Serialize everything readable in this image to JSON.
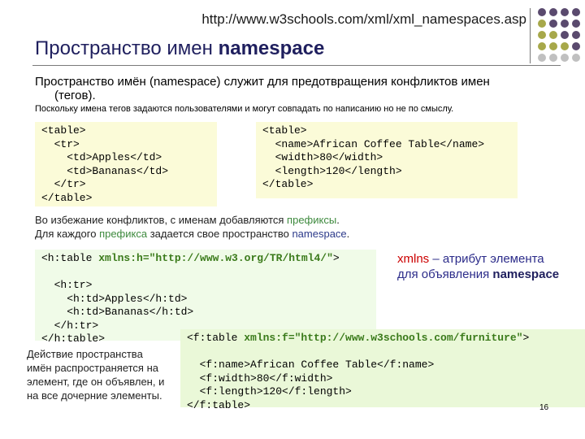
{
  "header": {
    "url": "http://www.w3schools.com/xml/xml_namespaces.asp",
    "title_normal": "Пространство имен ",
    "title_bold": "namespace",
    "dot_colors": [
      "#5a4a6e",
      "#5a4a6e",
      "#5a4a6e",
      "#5a4a6e",
      "#a7a84a",
      "#5a4a6e",
      "#5a4a6e",
      "#5a4a6e",
      "#a7a84a",
      "#a7a84a",
      "#5a4a6e",
      "#5a4a6e",
      "#a7a84a",
      "#a7a84a",
      "#a7a84a",
      "#5a4a6e",
      "#c0c0c0",
      "#c0c0c0",
      "#c0c0c0",
      "#c0c0c0"
    ]
  },
  "intro": {
    "bold_lead": "Пространство имён",
    "text1": " (namespace) служит для предотвращения конфликтов имен",
    "text2": "(тегов).",
    "small_note": "Поскольку имена тегов задаются пользователями и могут совпадать по написанию но не по смыслу."
  },
  "code1": {
    "lines": [
      "<table>",
      "  <tr>",
      "    <td>Apples</td>",
      "    <td>Bananas</td>",
      "  </tr>",
      "</table>"
    ]
  },
  "code2": {
    "lines": [
      "<table>",
      "  <name>African Coffee Table</name>",
      "  <width>80</width>",
      "  <length>120</length>",
      "</table>"
    ]
  },
  "prefix_note": {
    "line1_a": "Во избежание конфликтов, с именам добавляются ",
    "line1_b": "префиксы",
    "line1_c": ".",
    "line2_a": "Для каждого ",
    "line2_b": "префикса",
    "line2_c": " задается свое пространство ",
    "line2_d": "namespace",
    "line2_e": "."
  },
  "code3": {
    "first_a": "<h:table ",
    "first_attr": "xmlns:h=\"http://www.w3.org/TR/html4/\"",
    "first_c": ">",
    "lines": [
      "  <h:tr>",
      "    <h:td>Apples</h:td>",
      "    <h:td>Bananas</h:td>",
      "  </h:tr>",
      "</h:table>"
    ]
  },
  "xmlns_note": {
    "kw": "xmlns",
    "text": " – атрибут элемента для объявления ",
    "ns": "namespace"
  },
  "code4": {
    "first_a": "<f:table ",
    "first_attr": "xmlns:f=\"http://www.w3schools.com/furniture\"",
    "first_c": ">",
    "lines": [
      "  <f:name>African Coffee Table</f:name>",
      "  <f:width>80</f:width>",
      "  <f:length>120</f:length>",
      "</f:table>"
    ]
  },
  "scope_note": "Действие пространства имён распространяется на элемент, где он объявлен, и на все дочерние элементы.",
  "page_number": "16"
}
